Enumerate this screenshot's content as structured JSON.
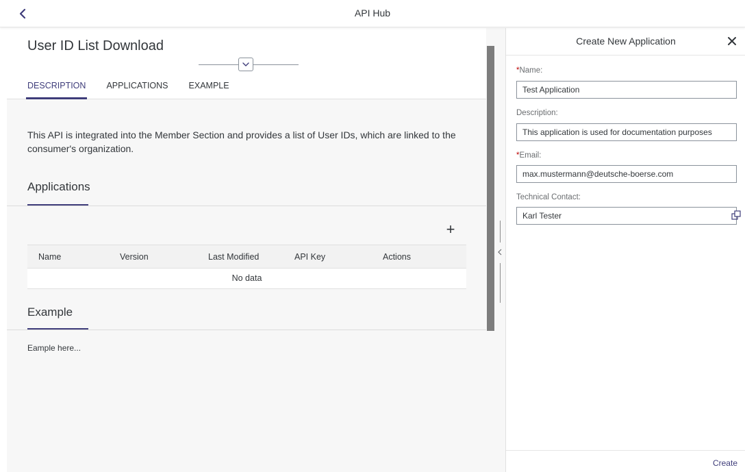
{
  "topbar": {
    "title": "API Hub",
    "back_icon": "chevron-left-icon"
  },
  "main": {
    "title": "User ID List Download",
    "tabs": [
      {
        "label": "DESCRIPTION",
        "active": true
      },
      {
        "label": "APPLICATIONS",
        "active": false
      },
      {
        "label": "EXAMPLE",
        "active": false
      }
    ],
    "description": "This API is integrated into the Member Section and provides a list of User IDs, which are linked to the consumer's organization.",
    "applications": {
      "title": "Applications",
      "add_label": "+",
      "columns": [
        "Name",
        "Version",
        "Last Modified",
        "API Key",
        "Actions"
      ],
      "empty_text": "No data"
    },
    "example": {
      "title": "Example",
      "text": "Eample here..."
    }
  },
  "panel": {
    "title": "Create New Application",
    "close_icon": "close-icon",
    "fields": {
      "name": {
        "required_mark": "*",
        "label": "Name:",
        "value": "Test Application"
      },
      "description": {
        "label": "Description:",
        "value": "This application is used for documentation purposes"
      },
      "email": {
        "required_mark": "*",
        "label": "Email:",
        "value": "max.mustermann@deutsche-boerse.com"
      },
      "technical_contact": {
        "label": "Technical Contact:",
        "value": "Karl Tester",
        "help_icon": "value-help-icon"
      }
    },
    "create_label": "Create"
  },
  "colors": {
    "accent": "#3e3c7a",
    "required": "#bb0000",
    "text": "#32363a",
    "background": "#f7f7f7"
  }
}
